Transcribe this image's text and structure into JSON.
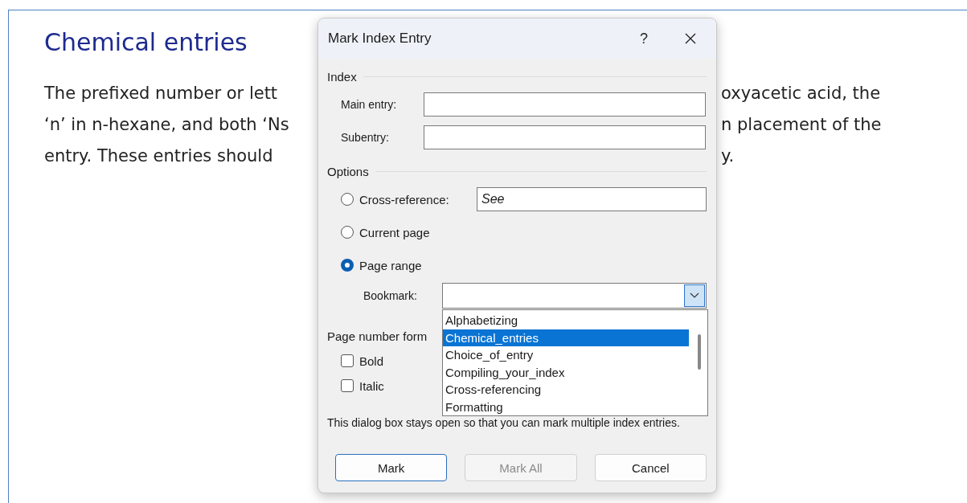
{
  "document": {
    "heading": "Chemical entries",
    "lines": [
      {
        "left": "The prefixed number or lett",
        "right": "oxyacetic acid, the"
      },
      {
        "left": "‘n’ in n-hexane, and both ‘Ns",
        "right": "n placement of the"
      },
      {
        "left": "entry. These entries should",
        "right": "y."
      }
    ]
  },
  "dialog": {
    "title": "Mark Index Entry",
    "help_button": "?",
    "index_section": "Index",
    "fields": [
      {
        "label": "Main entry:"
      },
      {
        "label": "Subentry:"
      }
    ],
    "options_section": "Options",
    "options": [
      {
        "label": "Cross-reference:",
        "selected": false,
        "kind": "field",
        "value": "See"
      },
      {
        "label": "Current page",
        "selected": false,
        "kind": "plain"
      },
      {
        "label": "Page range",
        "selected": true,
        "kind": "plain"
      }
    ],
    "bookmark": {
      "label": "Bookmark:",
      "list": [
        {
          "label": "Alphabetizing",
          "selected": false
        },
        {
          "label": "Chemical_entries",
          "selected": true
        },
        {
          "label": "Choice_of_entry",
          "selected": false
        },
        {
          "label": "Compiling_your_index",
          "selected": false
        },
        {
          "label": "Cross-referencing",
          "selected": false
        },
        {
          "label": "Formatting",
          "selected": false
        }
      ]
    },
    "page_number_format": {
      "label": "Page number form",
      "checkboxes": [
        {
          "label": "Bold",
          "checked": false
        },
        {
          "label": "Italic",
          "checked": false
        }
      ]
    },
    "note": "This dialog box stays open so that you can mark multiple index entries.",
    "buttons": [
      {
        "label": "Mark",
        "default": true,
        "disabled": false
      },
      {
        "label": "Mark All",
        "default": false,
        "disabled": true
      },
      {
        "label": "Cancel",
        "default": false,
        "disabled": false
      }
    ]
  }
}
